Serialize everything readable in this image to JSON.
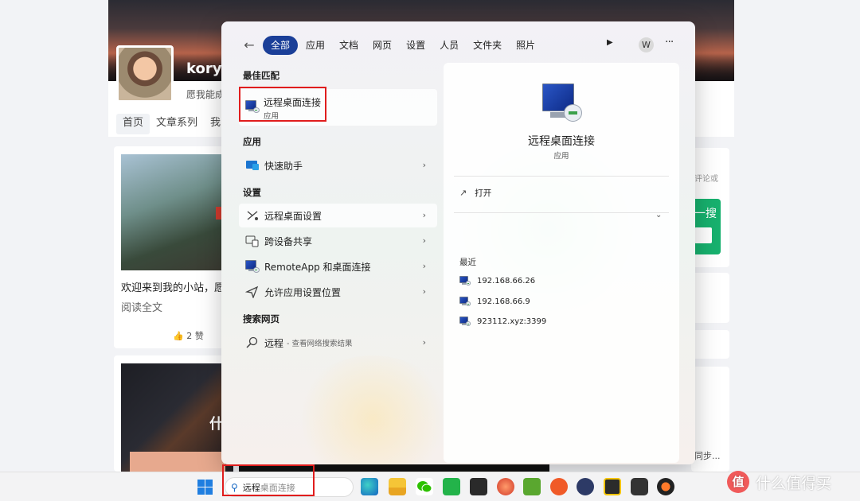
{
  "blog": {
    "username": "koryi",
    "motto": "愿我能成",
    "nav": [
      "首页",
      "文章系列",
      "我"
    ],
    "post_excerpt": "欢迎来到我的小站，愿",
    "read_more": "阅读全文",
    "likes": "2 赞",
    "side_hint": "评论或",
    "side_button": "一搜",
    "side_footer": "同步..."
  },
  "menu": {
    "tabs": [
      "全部",
      "应用",
      "文档",
      "网页",
      "设置",
      "人员",
      "文件夹",
      "照片"
    ],
    "user_initial": "W",
    "best_match": {
      "heading": "最佳匹配",
      "title": "远程桌面连接",
      "subtitle": "应用"
    },
    "apps": {
      "heading": "应用",
      "items": [
        {
          "label": "快速助手",
          "icon": "quick-assist-icon"
        }
      ]
    },
    "settings": {
      "heading": "设置",
      "items": [
        {
          "label": "远程桌面设置",
          "icon": "remote-desktop-settings-icon"
        },
        {
          "label": "跨设备共享",
          "icon": "share-devices-icon"
        },
        {
          "label": "RemoteApp 和桌面连接",
          "icon": "remoteapp-icon"
        },
        {
          "label": "允许应用设置位置",
          "icon": "location-icon"
        }
      ]
    },
    "web": {
      "heading": "搜索网页",
      "query": "远程",
      "hint": "- 查看网络搜索结果"
    },
    "detail": {
      "title": "远程桌面连接",
      "subtitle": "应用",
      "open_label": "打开",
      "recent_heading": "最近",
      "recent": [
        "192.168.66.26",
        "192.168.66.9",
        "923112.xyz:3399"
      ]
    }
  },
  "taskbar": {
    "search_typed": "远程",
    "search_suggestion": "桌面连接",
    "apps": [
      "edge-icon",
      "file-explorer-icon",
      "wechat-icon",
      "green-app-icon",
      "terminal-icon",
      "red-swirl-icon",
      "green-doc-icon",
      "pen-icon",
      "cat-icon",
      "app-icon",
      "bilibili-icon",
      "media-player-icon"
    ],
    "colors": {
      "accent": "#1b3f98",
      "highlight_box": "#e01d1d"
    }
  },
  "watermark": {
    "text": "什么值得买",
    "logo": "值"
  }
}
